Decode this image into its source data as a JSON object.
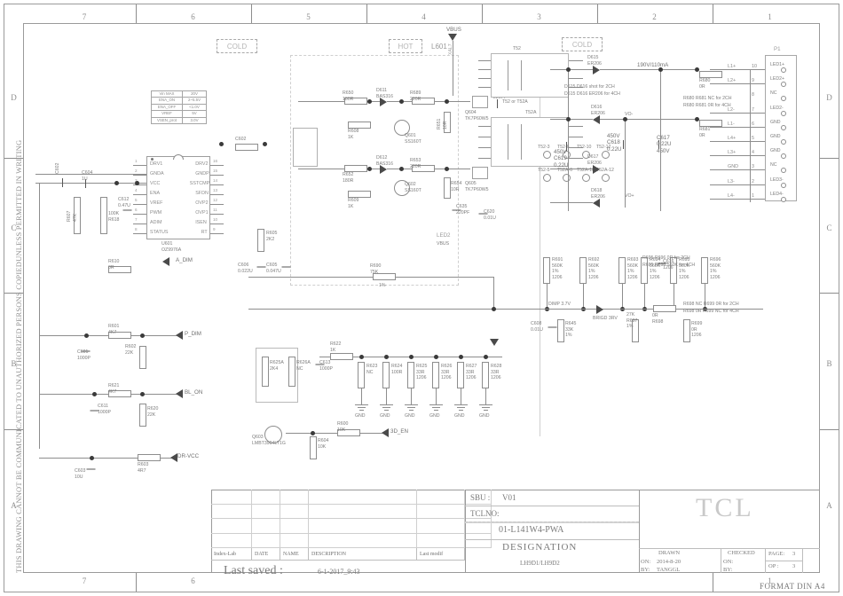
{
  "sheet": {
    "side_note": "THIS DRAWING CANNOT BE COMMUNICATED TO UNAUTHORIZED PERSONS COPIEDUNLESS PERMITTED IN WRITING",
    "format": "FORMAT DIN A4",
    "columns": [
      "7",
      "6",
      "5",
      "4",
      "3",
      "2",
      "1"
    ],
    "rows": [
      "D",
      "C",
      "B",
      "A"
    ]
  },
  "zones": {
    "cold_left": "COLD",
    "hot": "HOT",
    "cold_right": "COLD"
  },
  "param_table": {
    "rows": [
      [
        "Vin MAX",
        "20V"
      ],
      [
        "ENA_ON",
        "2~5.5V"
      ],
      [
        "ENA_OFF",
        "<1.0V"
      ],
      [
        "VREF",
        "5V"
      ],
      [
        "VSEN_prot",
        "3.0V"
      ]
    ]
  },
  "ic": {
    "ref": "U601",
    "part": "OZ9976A",
    "pins_left": [
      {
        "n": "1",
        "name": "DRV1"
      },
      {
        "n": "2",
        "name": "GNDA"
      },
      {
        "n": "3",
        "name": "VCC"
      },
      {
        "n": "4",
        "name": "ENA"
      },
      {
        "n": "5",
        "name": "VREF"
      },
      {
        "n": "6",
        "name": "PWM"
      },
      {
        "n": "7",
        "name": "ADIM"
      },
      {
        "n": "8",
        "name": "STATUS"
      }
    ],
    "pins_right": [
      {
        "n": "16",
        "name": "DRV2"
      },
      {
        "n": "15",
        "name": "GNDP"
      },
      {
        "n": "14",
        "name": "SSTCMP"
      },
      {
        "n": "13",
        "name": "SFDN"
      },
      {
        "n": "12",
        "name": "OVP2"
      },
      {
        "n": "11",
        "name": "OVP1"
      },
      {
        "n": "10",
        "name": "ISEN"
      },
      {
        "n": "9",
        "name": "RT"
      }
    ]
  },
  "nets": {
    "vbus": "VBUS",
    "p_dim": "P_DIM",
    "bl_on": "BL_ON",
    "a_dim": "A_DIM",
    "dr_vcc": "DR-VCC",
    "en_3d": "3D_EN",
    "led_out": "190V/110mA",
    "led1p": "LED1+",
    "led2p": "LED2+",
    "led3m": "LED3-",
    "led4m": "LED4-",
    "vop": "VO+",
    "vom": "VO-",
    "dim_ref": "DIMP 3.7V",
    "brightness": "BRIGD 3RV"
  },
  "components": {
    "left": [
      {
        "ref": "C604",
        "val": "1U"
      },
      {
        "ref": "C602",
        "val": ""
      },
      {
        "ref": "R607",
        "val": "47K"
      },
      {
        "ref": "R618",
        "val": "100K"
      },
      {
        "ref": "C612",
        "val": "0.47U"
      },
      {
        "ref": "R610",
        "val": "0R"
      },
      {
        "ref": "R601",
        "val": "4K7"
      },
      {
        "ref": "C601",
        "val": "1000P"
      },
      {
        "ref": "R602",
        "val": "22K"
      },
      {
        "ref": "R621",
        "val": "4K7"
      },
      {
        "ref": "C611",
        "val": "1000P"
      },
      {
        "ref": "R620",
        "val": "22K"
      },
      {
        "ref": "R603",
        "val": "4R7"
      },
      {
        "ref": "C603",
        "val": "10U"
      },
      {
        "ref": "GND",
        "val": ""
      }
    ],
    "center": [
      {
        "ref": "R625A",
        "val": "2K4"
      },
      {
        "ref": "R626A",
        "val": "NC"
      },
      {
        "ref": "C613",
        "val": "1000P"
      },
      {
        "ref": "Q603",
        "val": "LMBT3904LT1G"
      },
      {
        "ref": "R604",
        "val": "10K"
      },
      {
        "ref": "R600",
        "val": "10K"
      },
      {
        "ref": "R622",
        "val": "1K"
      },
      {
        "ref": "R623",
        "val": "NC"
      },
      {
        "ref": "R624",
        "val": "100R"
      },
      {
        "ref": "R625",
        "val": "33R",
        "pkg": "1206"
      },
      {
        "ref": "R626",
        "val": "33R",
        "pkg": "1206"
      },
      {
        "ref": "R627",
        "val": "33R",
        "pkg": "1206"
      },
      {
        "ref": "R628",
        "val": "33R",
        "pkg": "1206"
      },
      {
        "ref": "R690",
        "val": "75K",
        "tol": "1%"
      }
    ],
    "driver": [
      {
        "ref": "R650",
        "val": "180R"
      },
      {
        "ref": "D611",
        "val": "BAS316"
      },
      {
        "ref": "R689",
        "val": "220R"
      },
      {
        "ref": "R608",
        "val": "1K"
      },
      {
        "ref": "Q601",
        "val": "SS160T"
      },
      {
        "ref": "R651",
        "val": "10R"
      },
      {
        "ref": "R652",
        "val": "180R"
      },
      {
        "ref": "D612",
        "val": "BAS316"
      },
      {
        "ref": "R653",
        "val": "220R"
      },
      {
        "ref": "R609",
        "val": "1K"
      },
      {
        "ref": "Q602",
        "val": "SS160T"
      },
      {
        "ref": "R654",
        "val": "10R"
      },
      {
        "ref": "Q604",
        "val": "TK7P60W5"
      },
      {
        "ref": "Q605",
        "val": "TK7P60W5"
      },
      {
        "ref": "C634",
        "val": "220PF"
      },
      {
        "ref": "C635",
        "val": "220PF"
      },
      {
        "ref": "C620",
        "val": "0.01U"
      },
      {
        "ref": "C606",
        "val": "0.022U"
      },
      {
        "ref": "C605",
        "val": "0.047U"
      },
      {
        "ref": "R605",
        "val": "2K2"
      },
      {
        "ref": "L601",
        "val": ""
      },
      {
        "ref": "LED2",
        "val": "VBUS"
      }
    ],
    "transformers": [
      {
        "ref": "T52",
        "note": "T52 or T52A"
      },
      {
        "ref": "T52A",
        "note": ""
      }
    ],
    "rect": [
      {
        "ref": "D615",
        "val": "ER206"
      },
      {
        "ref": "D616",
        "val": "ER206"
      },
      {
        "ref": "D617",
        "val": "ER206"
      },
      {
        "ref": "D618",
        "val": "ER206"
      },
      {
        "ref": "C617",
        "val": "0.22U",
        "volt": "450V"
      },
      {
        "ref": "C618",
        "val": "0.22U",
        "volt": "450V"
      },
      {
        "ref": "C619",
        "val": "0.22U",
        "volt": "450V"
      },
      {
        "ref": "R680",
        "val": "0R"
      },
      {
        "ref": "R681",
        "val": "0R"
      }
    ],
    "sense": [
      {
        "ref": "R691",
        "val": "560K",
        "tol": "1%",
        "pkg": "1206"
      },
      {
        "ref": "R692",
        "val": "560K",
        "tol": "1%",
        "pkg": "1206"
      },
      {
        "ref": "R693",
        "val": "560K",
        "tol": "1%",
        "pkg": "1206"
      },
      {
        "ref": "R694",
        "val": "560K",
        "tol": "1%",
        "pkg": "1206"
      },
      {
        "ref": "R695",
        "val": "560K",
        "tol": "1%",
        "pkg": "1206"
      },
      {
        "ref": "R696",
        "val": "560K",
        "tol": "1%",
        "pkg": "1206"
      },
      {
        "ref": "R645",
        "val": "33K",
        "tol": "1%"
      },
      {
        "ref": "R697",
        "val": "27K",
        "tol": "1%"
      },
      {
        "ref": "R698",
        "val": "0R"
      },
      {
        "ref": "R699",
        "val": "0R",
        "pkg": "1206"
      },
      {
        "ref": "C608",
        "val": "0.01U"
      },
      {
        "ref": "C616",
        "val": "",
        "pkg": "1206"
      }
    ]
  },
  "notes": {
    "diode_note1": "D615 D616 shot for 2CH",
    "diode_note2": "D615 D616 ER206 for 4CH",
    "res_note1": "R680 R681 NC for 2CH",
    "res_note2": "R680 R681 0R for 4CH",
    "res_note3": "R695 R696 0R for 2CH",
    "res_note4": "R695 R696 560K for 4CH",
    "res_note5": "R698 NC R699 0R for 2CH",
    "res_note6": "R698 0R R699 NC for 4CH"
  },
  "connector": {
    "name": "P1",
    "pins": [
      {
        "num": "10",
        "right": "LED1+",
        "left": "L1+"
      },
      {
        "num": "9",
        "right": "LED2+",
        "left": "L2+"
      },
      {
        "num": "8",
        "right": "NC",
        "left": ""
      },
      {
        "num": "7",
        "right": "LED2-",
        "left": "L2-"
      },
      {
        "num": "6",
        "right": "GND",
        "left": "L1-"
      },
      {
        "num": "5",
        "right": "GND",
        "left": "L4+"
      },
      {
        "num": "4",
        "right": "GND",
        "left": "L3+"
      },
      {
        "num": "3",
        "right": "NC",
        "left": "GND"
      },
      {
        "num": "2",
        "right": "LED3-",
        "left": "L3-"
      },
      {
        "num": "1",
        "right": "LED4-",
        "left": "L4-"
      }
    ]
  },
  "title_block": {
    "col_headers": [
      "Index-Lab",
      "DATE",
      "NAME",
      "DESCRIPTION",
      "Last modif"
    ],
    "last_saved_label": "Last saved :",
    "last_saved_value": "6-1-2017_9:43",
    "sbu_label": "SBU :",
    "sbu_value": "V01",
    "tclno_label": "TCLNO:",
    "part_number": "01-L141W4-PWA",
    "designation_label": "DESIGNATION",
    "designation_value": "LH9D1/LH9D2",
    "brand": "TCL",
    "drawn_label": "DRAWN",
    "drawn_on_label": "ON:",
    "drawn_on_value": "2014-8-20",
    "drawn_by_label": "BY:",
    "drawn_by_value": "TANGGL",
    "checked_label": "CHECKED",
    "checked_on_label": "ON:",
    "checked_by_label": "BY:",
    "page_label": "PAGE:",
    "page_value": "3",
    "of_label": "OP :",
    "of_value": "3"
  }
}
